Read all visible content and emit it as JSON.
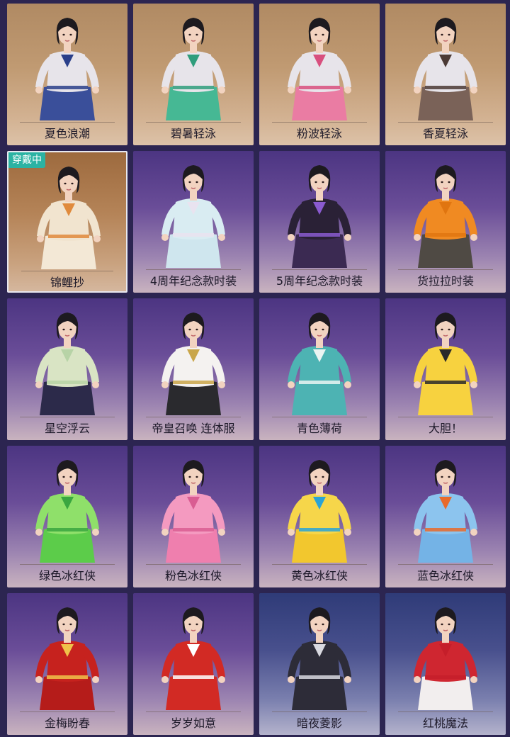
{
  "wearing_badge": "穿戴中",
  "outfits": [
    {
      "name": "夏色浪潮",
      "bg": "summer",
      "top": "#e7e4ea",
      "bottom": "#3a4f9a",
      "accent": "#2a3f8a"
    },
    {
      "name": "碧暑轻泳",
      "bg": "summer",
      "top": "#e7e4ea",
      "bottom": "#46b894",
      "accent": "#2f9d7c"
    },
    {
      "name": "粉波轻泳",
      "bg": "summer",
      "top": "#e7e4ea",
      "bottom": "#ea7ca3",
      "accent": "#d84f7e"
    },
    {
      "name": "香夏轻泳",
      "bg": "summer",
      "top": "#e7e4ea",
      "bottom": "#7a6258",
      "accent": "#4b3a35"
    },
    {
      "name": "锦鲤抄",
      "bg": "gold",
      "top": "#f1e4cf",
      "bottom": "#f3e8d6",
      "accent": "#e08a3c",
      "selected": true
    },
    {
      "name": "4周年纪念款时装",
      "bg": "purple",
      "top": "#d9ecf2",
      "bottom": "#cfe6ee",
      "accent": "#e9e3f0"
    },
    {
      "name": "5周年纪念款时装",
      "bg": "purple",
      "top": "#2a2136",
      "bottom": "#3b2a52",
      "accent": "#8a5ad0"
    },
    {
      "name": "货拉拉时装",
      "bg": "purple",
      "top": "#f08a22",
      "bottom": "#4f4a44",
      "accent": "#e07510"
    },
    {
      "name": "星空浮云",
      "bg": "purple",
      "top": "#d9e4c4",
      "bottom": "#2c2a4a",
      "accent": "#b7d3a6"
    },
    {
      "name": "帝皇召唤 连体服",
      "bg": "purple",
      "top": "#f4f2f0",
      "bottom": "#2a2a2e",
      "accent": "#c9a64a"
    },
    {
      "name": "青色薄荷",
      "bg": "purple",
      "top": "#4db3b3",
      "bottom": "#4db3b3",
      "accent": "#eaf4f2"
    },
    {
      "name": "大胆！",
      "bg": "purple",
      "top": "#f7d23f",
      "bottom": "#f7d23f",
      "accent": "#2a2a2a"
    },
    {
      "name": "绿色冰红侠",
      "bg": "purple",
      "top": "#8fe06a",
      "bottom": "#5ccc4a",
      "accent": "#3aa640"
    },
    {
      "name": "粉色冰红侠",
      "bg": "purple",
      "top": "#f49ac0",
      "bottom": "#ef7fae",
      "accent": "#d95d92"
    },
    {
      "name": "黄色冰红侠",
      "bg": "purple",
      "top": "#f6d64a",
      "bottom": "#f2c72e",
      "accent": "#2aa3d6"
    },
    {
      "name": "蓝色冰红侠",
      "bg": "purple",
      "top": "#8cc4ee",
      "bottom": "#74b3e6",
      "accent": "#e86a2a"
    },
    {
      "name": "金梅盼春",
      "bg": "purple",
      "top": "#c6221e",
      "bottom": "#b51c1a",
      "accent": "#f0c24a"
    },
    {
      "name": "岁岁如意",
      "bg": "purple",
      "top": "#d22a24",
      "bottom": "#d22a24",
      "accent": "#ffffff"
    },
    {
      "name": "暗夜菱影",
      "bg": "blue",
      "top": "#2d2c38",
      "bottom": "#2d2c38",
      "accent": "#d9d9e0"
    },
    {
      "name": "红桃魔法",
      "bg": "blue",
      "top": "#cf2630",
      "bottom": "#f2eeee",
      "accent": "#c51e2a"
    }
  ]
}
